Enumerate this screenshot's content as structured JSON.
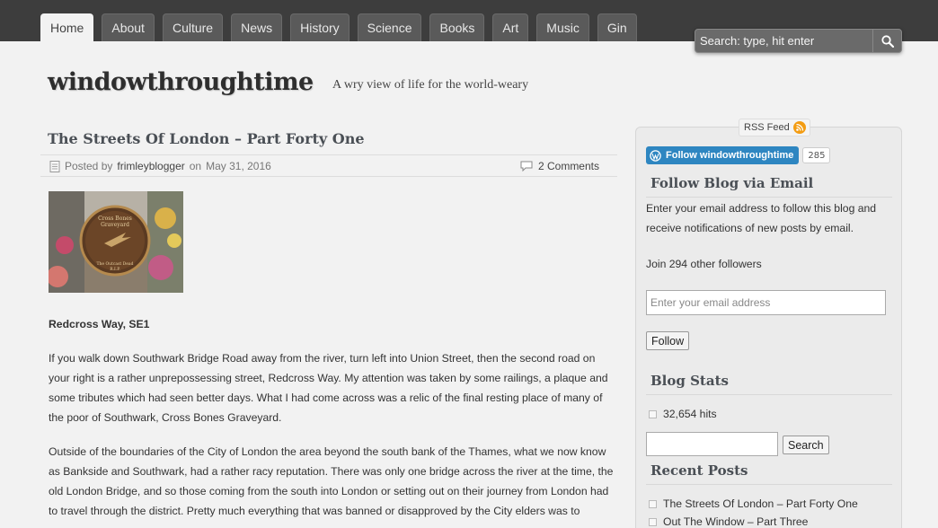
{
  "nav": {
    "tabs": [
      {
        "label": "Home",
        "active": true
      },
      {
        "label": "About",
        "active": false
      },
      {
        "label": "Culture",
        "active": false
      },
      {
        "label": "News",
        "active": false
      },
      {
        "label": "History",
        "active": false
      },
      {
        "label": "Science",
        "active": false
      },
      {
        "label": "Books",
        "active": false
      },
      {
        "label": "Art",
        "active": false
      },
      {
        "label": "Music",
        "active": false
      },
      {
        "label": "Gin",
        "active": false
      }
    ]
  },
  "search": {
    "placeholder": "Search: type, hit enter",
    "icon": "search-icon"
  },
  "site": {
    "title": "windowthroughtime",
    "tagline": "A wry view of life for the world-weary"
  },
  "post": {
    "title": "The Streets Of London – Part Forty One",
    "posted_by_label": "Posted by",
    "author": "frimleyblogger",
    "on_label": "on",
    "date": "May 31, 2016",
    "comments": "2 Comments",
    "image_sign": {
      "line1": "Cross Bones",
      "line2": "Graveyard",
      "bottom1": "The Outcast Dead",
      "bottom2": "R.I.P."
    },
    "subhead": "Redcross Way, SE1",
    "paragraphs": [
      "If you walk down Southwark Bridge Road away from the river, turn left into Union Street, then the second road on your right is a rather unprepossessing street, Redcross Way. My attention was taken by some railings, a plaque and some tributes which had seen better days. What I had come across was a relic of the final resting place of many of the poor of Southwark, Cross Bones Graveyard.",
      "Outside of the boundaries of the City of London the area beyond the south bank of the Thames, what we now know as Bankside and Southwark, had a rather racy reputation. There was only one bridge across the river at the time, the old London Bridge, and so those coming from the south into London or setting out on their journey from London had to travel through the district. Pretty much everything that was banned or disapproved by the City elders was to"
    ]
  },
  "sidebar": {
    "rss_label": "RSS Feed",
    "follow_button": "Follow windowthroughtime",
    "follow_count": "285",
    "email_widget": {
      "title": "Follow Blog via Email",
      "description": "Enter your email address to follow this blog and receive notifications of new posts by email.",
      "followers": "Join 294 other followers",
      "placeholder": "Enter your email address",
      "button": "Follow"
    },
    "stats": {
      "title": "Blog Stats",
      "hits": "32,654 hits"
    },
    "search_button": "Search",
    "recent": {
      "title": "Recent Posts",
      "items": [
        "The Streets Of London – Part Forty One",
        "Out The Window – Part Three"
      ]
    }
  },
  "colors": {
    "topbar": "#3d3d3d",
    "tab": "#5a5a5a",
    "follow_blue": "#2e86c1",
    "rss_orange": "#f39c12"
  }
}
